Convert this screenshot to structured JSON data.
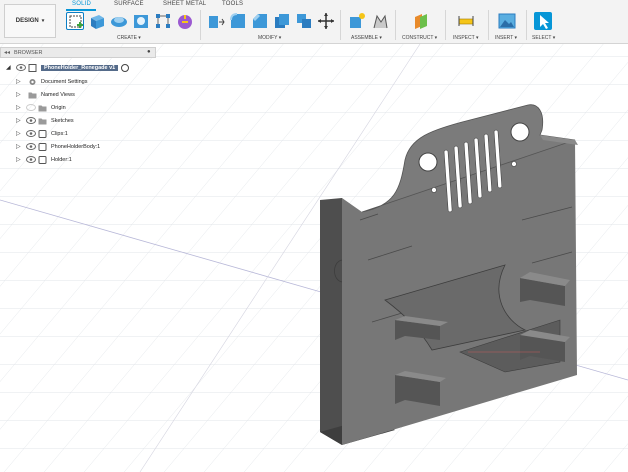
{
  "workspace": {
    "label": "DESIGN"
  },
  "tabs": [
    {
      "label": "SOLID",
      "active": true
    },
    {
      "label": "SURFACE",
      "active": false
    },
    {
      "label": "SHEET METAL",
      "active": false
    },
    {
      "label": "TOOLS",
      "active": false
    }
  ],
  "groups": {
    "create": "CREATE",
    "modify": "MODIFY",
    "assemble": "ASSEMBLE",
    "construct": "CONSTRUCT",
    "inspect": "INSPECT",
    "insert": "INSERT",
    "select": "SELECT"
  },
  "browser": {
    "title": "BROWSER",
    "root": "PhoneHolder_Renegade v1",
    "items": [
      {
        "label": "Document Settings",
        "icon": "gear-icon"
      },
      {
        "label": "Named Views",
        "icon": "folder-icon"
      },
      {
        "label": "Origin",
        "icon": "folder-icon"
      },
      {
        "label": "Sketches",
        "icon": "folder-icon"
      },
      {
        "label": "Clips:1",
        "icon": "component-icon"
      },
      {
        "label": "PhoneHolderBody:1",
        "icon": "component-icon"
      },
      {
        "label": "Holder:1",
        "icon": "component-icon"
      }
    ]
  },
  "colors": {
    "accent": "#0696d7",
    "model": "#6d6d6d",
    "grid": "#d9dde3"
  }
}
